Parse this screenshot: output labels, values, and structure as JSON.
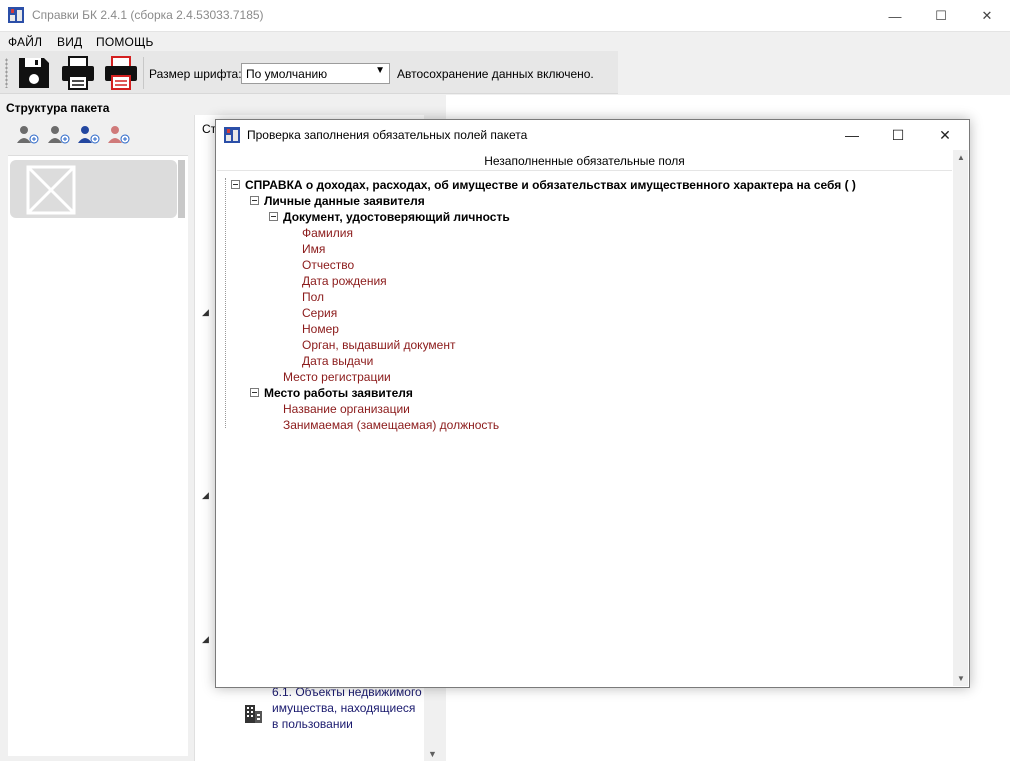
{
  "window": {
    "title": "Справки БК 2.4.1 (сборка 2.4.53033.7185)",
    "minimize": "—",
    "maximize": "☐",
    "close": "✕"
  },
  "menu": [
    "ФАЙЛ",
    "ВИД",
    "ПОМОЩЬ"
  ],
  "toolbar": {
    "font_size_label": "Размер шрифта:",
    "font_size_value": "По умолчанию",
    "autosave_status": "Автосохранение данных включено."
  },
  "left_panel": {
    "title": "Структура пакета"
  },
  "middle_panel": {
    "header": "Ст",
    "item_text": "6.1. Объекты недвижимого имущества, находящиеся в пользовании"
  },
  "dialog": {
    "title": "Проверка заполнения обязательных полей пакета",
    "minimize": "—",
    "maximize": "☐",
    "close": "✕",
    "column_header": "Незаполненные обязательные поля",
    "tree": {
      "root": "СПРАВКА о доходах, расходах, об имуществе и обязательствах имущественного характера на себя (  )",
      "personal": "Личные данные заявителя",
      "document": "Документ, удостоверяющий личность",
      "document_fields": [
        "Фамилия",
        "Имя",
        "Отчество",
        "Дата рождения",
        "Пол",
        "Серия",
        "Номер",
        "Орган, выдавший документ",
        "Дата выдачи"
      ],
      "registration": "Место регистрации",
      "work": "Место работы заявителя",
      "work_fields": [
        "Название организации",
        "Занимаемая (замещаемая) должность"
      ]
    }
  },
  "colors": {
    "missing_field": "#8b1a1a",
    "link_text": "#1a1a6e"
  }
}
